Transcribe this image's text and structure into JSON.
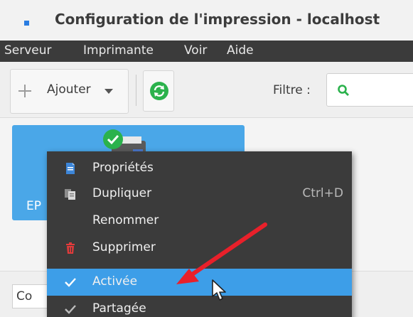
{
  "window": {
    "title": "Configuration de l'impression - localhost"
  },
  "menubar": {
    "items": [
      "Serveur",
      "Imprimante",
      "Voir",
      "Aide"
    ]
  },
  "toolbar": {
    "add_label": "Ajouter",
    "filter_label": "Filtre :",
    "filter_value": ""
  },
  "printer": {
    "name": "EP"
  },
  "status": {
    "text": "Co"
  },
  "context_menu": {
    "items": [
      {
        "label": "Propriétés",
        "icon": "properties-icon",
        "shortcut": ""
      },
      {
        "label": "Dupliquer",
        "icon": "duplicate-icon",
        "shortcut": "Ctrl+D"
      },
      {
        "label": "Renommer",
        "icon": "",
        "shortcut": ""
      },
      {
        "label": "Supprimer",
        "icon": "trash-icon",
        "shortcut": ""
      },
      {
        "label": "Activée",
        "icon": "check-icon",
        "shortcut": "",
        "selected": true
      },
      {
        "label": "Partagée",
        "icon": "check-icon",
        "shortcut": ""
      }
    ]
  },
  "colors": {
    "menubar_bg": "#3b3b3b",
    "selection": "#3d9ee8",
    "printer_card": "#4aa7e8",
    "accent_green": "#2bb24c",
    "annotation_red": "#e8202a",
    "delete_red": "#e23b3b"
  }
}
